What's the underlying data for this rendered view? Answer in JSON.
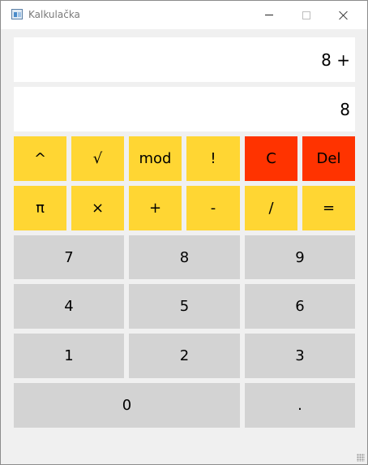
{
  "window": {
    "title": "Kalkulačka",
    "controls": {
      "minimize_icon": "minimize-icon",
      "maximize_icon": "maximize-icon",
      "close_icon": "close-icon"
    }
  },
  "display": {
    "expression": "8 +",
    "value": "8"
  },
  "operators_row1": [
    "^",
    "√",
    "mod",
    "!",
    "C",
    "Del"
  ],
  "operators_row2": [
    "π",
    "×",
    "+",
    "-",
    "/",
    "="
  ],
  "digits": {
    "row1": [
      "7",
      "8",
      "9"
    ],
    "row2": [
      "4",
      "5",
      "6"
    ],
    "row3": [
      "1",
      "2",
      "3"
    ],
    "row4": [
      "0",
      "."
    ]
  },
  "colors": {
    "operator": "#ffd633",
    "clear": "#ff3300",
    "digit": "#d3d3d3"
  }
}
